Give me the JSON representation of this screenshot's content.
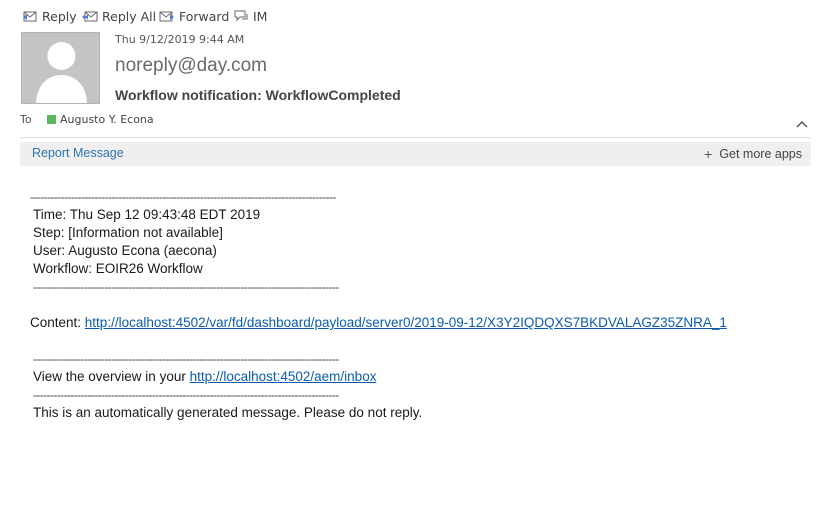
{
  "toolbar": {
    "reply": "Reply",
    "reply_all": "Reply All",
    "forward": "Forward",
    "im": "IM"
  },
  "message": {
    "date": "Thu 9/12/2019 9:44 AM",
    "sender": "noreply@day.com",
    "subject": "Workflow notification: WorkflowCompleted",
    "to_label": "To",
    "recipient": "Augusto Y. Econa",
    "recipient_status_color": "#5cb85c"
  },
  "bar": {
    "report": "Report Message",
    "get_apps": "Get more apps"
  },
  "body": {
    "separator": "------------------------------------------------------------------------------------------",
    "time": "Time: Thu Sep 12 09:43:48 EDT 2019",
    "step": "Step: [Information not available]",
    "user": "User: Augusto Econa (aecona)",
    "workflow": "Workflow: EOIR26 Workflow",
    "content_label": "Content: ",
    "content_link": "http://localhost:4502/var/fd/dashboard/payload/server0/2019-09-12/X3Y2IQDQXS7BKDVALAGZ35ZNRA_1",
    "overview_label": "View the overview in your ",
    "overview_link": "http://localhost:4502/aem/inbox",
    "footer": "This is an automatically generated message. Please do not reply."
  }
}
